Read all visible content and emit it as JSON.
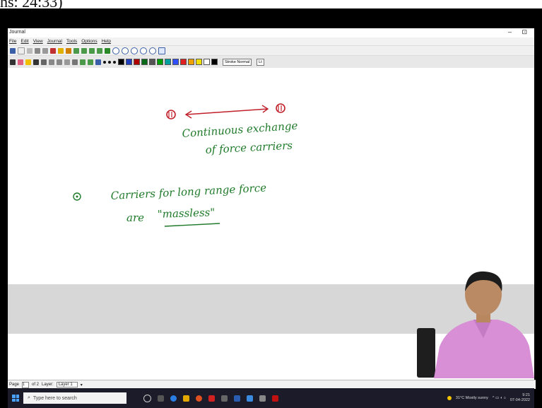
{
  "header_fragment": "hs: 24:33)",
  "window": {
    "title": "Journal",
    "controls": "– ⊡"
  },
  "menu": [
    "File",
    "Edit",
    "View",
    "Journal",
    "Tools",
    "Options",
    "Help"
  ],
  "toolbar": {
    "pen_style_label": "Stroke Normal",
    "pen_style_extra": "Lt"
  },
  "pen_colors": [
    "#000000",
    "#1f3fbf",
    "#b00000",
    "#0a6a1a",
    "#555555",
    "#00a000",
    "#00a0a0",
    "#3050ff",
    "#e02020",
    "#f0a000",
    "#f0e000",
    "#ffffff",
    "#000000"
  ],
  "handwriting": {
    "line1": "Continuous exchange",
    "line2": "of force carriers",
    "bullet_text_1": "Carriers for long range force",
    "bullet_text_2_prefix": "are",
    "bullet_text_2_quoted": "\"massless\"",
    "ink_color": "#1f7a2a",
    "marker_color": "#c0202a"
  },
  "statusbar": {
    "page_label": "Page",
    "page_value": "1",
    "page_of": "of 2",
    "layer_label": "Layer:",
    "layer_value": "Layer 1"
  },
  "taskbar": {
    "search_placeholder": "Type here to search",
    "weather": "31°C Mostly sunny",
    "time": "9:21",
    "date": "07-04-2022"
  }
}
